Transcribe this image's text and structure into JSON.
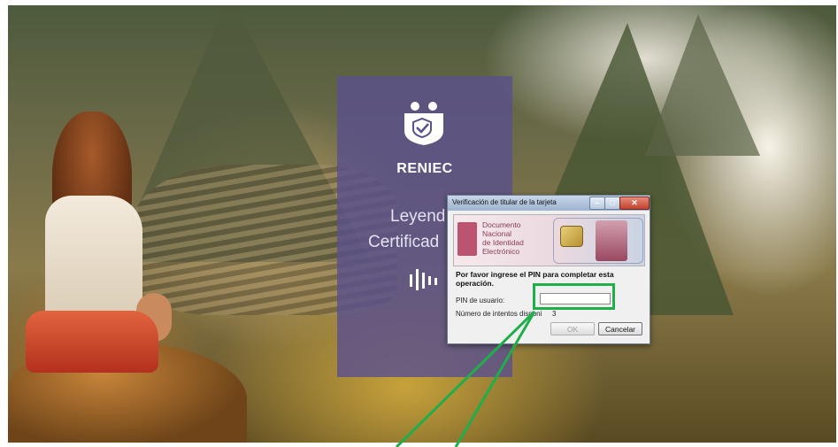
{
  "panel": {
    "brand": "RENIEC",
    "line1": "Leyend",
    "line2": "Certificad",
    "logo_icon": "reniec-shield-people-icon",
    "wave_icon": "audio-wave-icon"
  },
  "dialog": {
    "title": "Verificación de titular de la tarjeta",
    "window_buttons": {
      "minimize": "–",
      "maximize": "□",
      "close": "✕"
    },
    "banner": {
      "line1": "Documento",
      "line2": "Nacional",
      "line3": "de Identidad",
      "line4": "Electrónico"
    },
    "prompt": "Por favor ingrese el PIN para completar esta operación.",
    "pin_label": "PIN de usuario:",
    "pin_value": "",
    "attempts_label": "Número de intentos disponi",
    "attempts_value": "3",
    "ok_label": "OK",
    "cancel_label": "Cancelar"
  },
  "annotation": {
    "color": "#1fae4a"
  },
  "colors": {
    "panel": "#5a508c",
    "dialog_title": "#9eb3cf",
    "highlight": "#1fae4a"
  }
}
